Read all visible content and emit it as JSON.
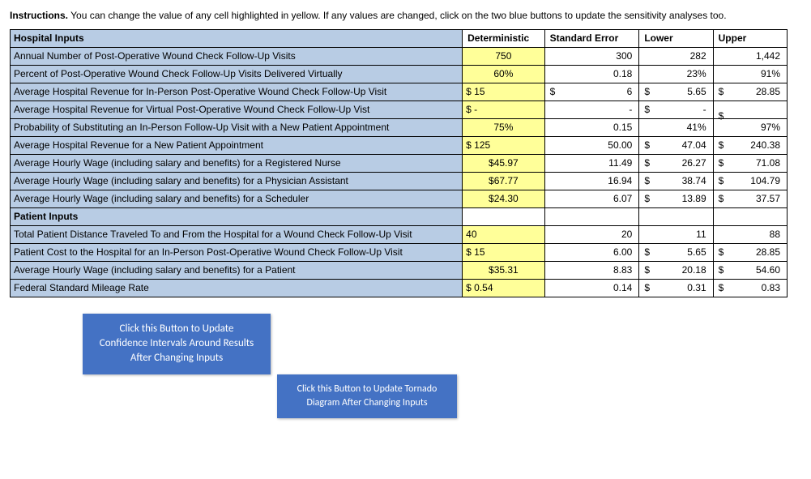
{
  "instructions": {
    "bold": "Instructions.",
    "text": " You can change the value of any cell highlighted in yellow. If any values are changed, click on the two blue buttons to update the sensitivity analyses too."
  },
  "headers": {
    "label": "Hospital Inputs",
    "det": "Deterministic",
    "se": "Standard Error",
    "lo": "Lower",
    "hi": "Upper"
  },
  "patient_header": "Patient Inputs",
  "rows": {
    "r1": {
      "label": "Annual Number of Post-Operative Wound Check Follow-Up Visits",
      "det": "750",
      "se": "300",
      "lo": "282",
      "hi": "1,442"
    },
    "r2": {
      "label": "Percent of Post-Operative Wound Check Follow-Up Visits Delivered Virtually",
      "det": "60%",
      "se": "0.18",
      "lo": "23%",
      "hi": "91%"
    },
    "r3": {
      "label": "Average Hospital Revenue for In-Person Post-Operative Wound Check Follow-Up Visit",
      "det": "$ 15",
      "se_sym": "$",
      "se": "6",
      "lo_sym": "$",
      "lo": "5.65",
      "hi_sym": "$",
      "hi": "28.85"
    },
    "r4": {
      "label": "Average Hospital Revenue for Virtual Post-Operative Wound Check Follow-Up Vist",
      "det": "$ -",
      "se": "-",
      "lo_sym": "$",
      "lo": "-",
      "hi_sym": "$",
      "hi": ""
    },
    "r5": {
      "label": "Probability of Substituting an In-Person Follow-Up Visit with a New Patient Appointment",
      "det": "75%",
      "se": "0.15",
      "lo": "41%",
      "hi": "97%"
    },
    "r6": {
      "label": "Average Hospital Revenue for a New Patient Appointment",
      "det": "$ 125",
      "se": "50.00",
      "lo_sym": "$",
      "lo": "47.04",
      "hi_sym": "$",
      "hi": "240.38"
    },
    "r7": {
      "label": "Average Hourly Wage (including salary and benefits) for a Registered Nurse",
      "det": "$45.97",
      "se": "11.49",
      "lo_sym": "$",
      "lo": "26.27",
      "hi_sym": "$",
      "hi": "71.08"
    },
    "r8": {
      "label": "Average Hourly Wage (including salary and benefits) for a Physician Assistant",
      "det": "$67.77",
      "se": "16.94",
      "lo_sym": "$",
      "lo": "38.74",
      "hi_sym": "$",
      "hi": "104.79"
    },
    "r9": {
      "label": "Average Hourly Wage (including salary and benefits) for a Scheduler",
      "det": "$24.30",
      "se": "6.07",
      "lo_sym": "$",
      "lo": "13.89",
      "hi_sym": "$",
      "hi": "37.57"
    },
    "p1": {
      "label": "Total Patient Distance Traveled To and From the Hospital for a Wound Check Follow-Up Visit",
      "det": "40",
      "se": "20",
      "lo": "11",
      "hi": "88"
    },
    "p2": {
      "label": "Patient Cost to the Hospital for an In-Person Post-Operative Wound Check Follow-Up Visit",
      "det": "$ 15",
      "se": "6.00",
      "lo_sym": "$",
      "lo": "5.65",
      "hi_sym": "$",
      "hi": "28.85"
    },
    "p3": {
      "label": "Average Hourly Wage (including salary and benefits) for a Patient",
      "det": "$35.31",
      "se": "8.83",
      "lo_sym": "$",
      "lo": "20.18",
      "hi_sym": "$",
      "hi": "54.60"
    },
    "p4": {
      "label": "Federal Standard Mileage Rate",
      "det": "$ 0.54",
      "se": "0.14",
      "lo_sym": "$",
      "lo": "0.31",
      "hi_sym": "$",
      "hi": "0.83"
    }
  },
  "buttons": {
    "update_ci": "Click this Button to Update Confidence Intervals Around Results After Changing Inputs",
    "update_tornado": "Click this Button to Update Tornado Diagram After Changing Inputs"
  }
}
